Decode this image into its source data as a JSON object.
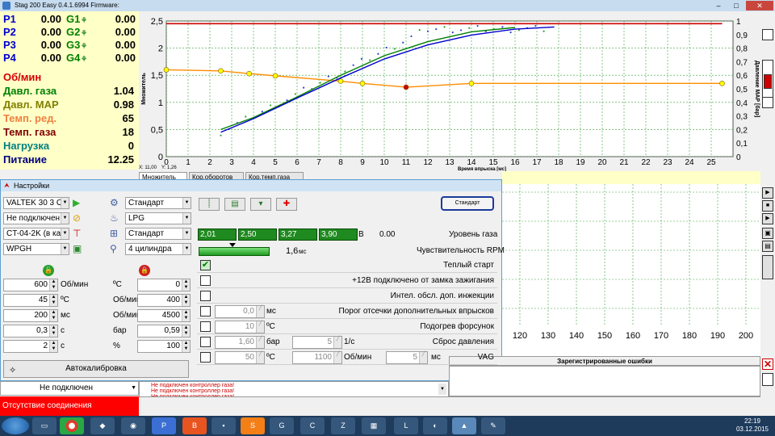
{
  "window": {
    "title": "Stag 200 Easy 0.4.1.6994 Firmware:"
  },
  "params": {
    "P": [
      {
        "label": "P1",
        "value": "0.00"
      },
      {
        "label": "P2",
        "value": "0.00"
      },
      {
        "label": "P3",
        "value": "0.00"
      },
      {
        "label": "P4",
        "value": "0.00"
      }
    ],
    "G": [
      {
        "label": "G1",
        "value": "0.00"
      },
      {
        "label": "G2",
        "value": "0.00"
      },
      {
        "label": "G3",
        "value": "0.00"
      },
      {
        "label": "G4",
        "value": "0.00"
      }
    ],
    "rows": [
      {
        "label": "Об/мин",
        "value": "",
        "color": "#d40000"
      },
      {
        "label": "Давл. газа",
        "value": "1.04",
        "color": "#008000"
      },
      {
        "label": "Давл. МАР",
        "value": "0.98",
        "color": "#808000"
      },
      {
        "label": "Темп. ред.",
        "value": "65",
        "color": "#f08040"
      },
      {
        "label": "Темп. газа",
        "value": "18",
        "color": "#800000"
      },
      {
        "label": "Нагрузка",
        "value": "0",
        "color": "#008080"
      },
      {
        "label": "Питание",
        "value": "12.25",
        "color": "#000080"
      }
    ]
  },
  "chart_data": {
    "type": "line",
    "xlabel": "Время впрыска [мс]",
    "ylabel": "Множитель",
    "ylabel_right": "Давление МАР [бар]",
    "xlim": [
      0,
      26
    ],
    "ylim": [
      0,
      2.5
    ],
    "ylim_right": [
      0,
      1
    ],
    "xticks": [
      0,
      1,
      2,
      3,
      4,
      5,
      6,
      7,
      8,
      9,
      10,
      11,
      12,
      13,
      14,
      15,
      16,
      17,
      18,
      19,
      20,
      21,
      22,
      23,
      24,
      25
    ],
    "yticks": [
      "0",
      "0,5",
      "1",
      "1,5",
      "2",
      "2,5"
    ],
    "yticks_right": [
      "0",
      "0,1",
      "0,2",
      "0,3",
      "0,4",
      "0,5",
      "0,6",
      "0,7",
      "0,8",
      "0,9",
      "1"
    ],
    "grid": true,
    "series": [
      {
        "color": "#ff8c00",
        "x": [
          0,
          2.5,
          3.8,
          5,
          8,
          9,
          11,
          14,
          25.5
        ],
        "y": [
          1.6,
          1.58,
          1.53,
          1.49,
          1.39,
          1.35,
          1.28,
          1.35,
          1.35
        ],
        "markers": true
      },
      {
        "color": "#cc0000",
        "x": [
          0,
          25.5
        ],
        "y": [
          2.45,
          2.45
        ],
        "markers": false
      },
      {
        "color": "#008000",
        "x": [
          2.5,
          4,
          6,
          8,
          10,
          12,
          14,
          16
        ],
        "y": [
          0.5,
          0.72,
          1.1,
          1.5,
          1.86,
          2.12,
          2.3,
          2.38
        ],
        "markers": false
      },
      {
        "color": "#0000cc",
        "x": [
          2.5,
          4,
          6,
          8,
          10,
          12,
          14,
          16,
          17.8
        ],
        "y": [
          0.45,
          0.7,
          1.08,
          1.45,
          1.8,
          2.06,
          2.24,
          2.35,
          2.39
        ],
        "markers": false
      }
    ],
    "cursor": {
      "x_label": "X: 11,00",
      "y_label": "Y: 1,26"
    }
  },
  "tabs": [
    {
      "label": "Множитель"
    },
    {
      "label": "Кор.оборотов"
    },
    {
      "label": "Кор.темп.газа"
    }
  ],
  "settings": {
    "title": "Настройки",
    "combos_left": [
      "VALTEK 30 3 Ом",
      "Не подключен",
      "CT-04-2K (в ка",
      "WPGH"
    ],
    "combos_mid": [
      "Стандарт",
      "LPG",
      "Стандарт",
      "4 цилиндра"
    ],
    "std_button": "Стандарт",
    "spins_left": [
      {
        "value": "600",
        "unit": "Об/мин"
      },
      {
        "value": "45",
        "unit": "ºС"
      },
      {
        "value": "200",
        "unit": "мс"
      },
      {
        "value": "0,3",
        "unit": "с"
      },
      {
        "value": "2",
        "unit": "с"
      }
    ],
    "spins_right": [
      {
        "unit": "ºС",
        "value": "0"
      },
      {
        "unit": "Об/мин",
        "value": "400"
      },
      {
        "unit": "Об/мин",
        "value": "4500"
      },
      {
        "unit": "бар",
        "value": "0,59"
      },
      {
        "unit": "%",
        "value": "100"
      }
    ],
    "autocal": "Автокалибровка",
    "level_bars": [
      "2,01",
      "2,50",
      "3,27",
      "3,90"
    ],
    "level_unit": "В",
    "level_value": "0.00",
    "level_label": "Уровень газа",
    "rpm_sens_value": "1,6",
    "rpm_sens_unit": "мс",
    "rpm_sens_label": "Чувствительность RPM",
    "checks": [
      {
        "label": "Теплый старт",
        "checked": true
      },
      {
        "label": "+12В подключено от замка зажигания",
        "checked": false
      },
      {
        "label": "Интел. обсл. доп. инжекции",
        "checked": false
      },
      {
        "label": "Порог отсечки дополнительных впрысков",
        "checked": false,
        "v1": "0,0",
        "u1": "мс"
      },
      {
        "label": "Подогрев форсунок",
        "checked": false,
        "v1": "10",
        "u1": "ºС"
      },
      {
        "label": "Сброс давления",
        "checked": false,
        "v1": "1,60",
        "u1": "бар",
        "v2": "5",
        "u2": "1/с"
      },
      {
        "label": "VAG",
        "checked": false,
        "v1": "50",
        "u1": "ºС",
        "v2": "1100",
        "u2": "Об/мин",
        "v3": "5",
        "u3": "мс"
      }
    ]
  },
  "lower_axis": [
    "120",
    "130",
    "140",
    "150",
    "160",
    "170",
    "180",
    "190",
    "200"
  ],
  "errors_title": "Зарегистрированные ошибки",
  "log": [
    "Не подключен контроллер газа!",
    "Не подключен контроллер газа!",
    "Не подключен контроллер газа!"
  ],
  "connection": "Не подключен",
  "status": "Отсутствие соединения",
  "clock": {
    "time": "22:19",
    "date": "03.12.2015"
  }
}
